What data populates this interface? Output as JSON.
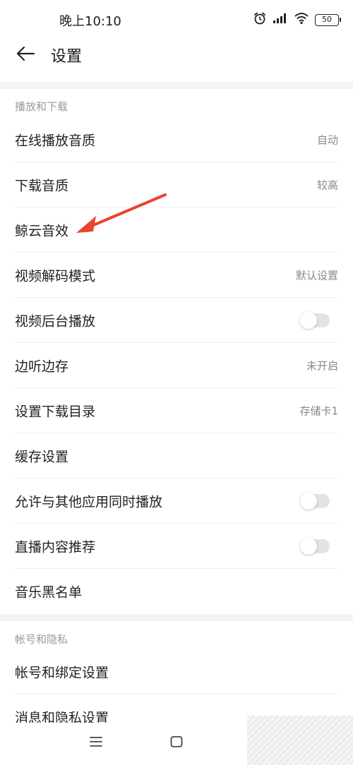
{
  "status_bar": {
    "time": "晚上10:10",
    "battery": "50"
  },
  "header": {
    "title": "设置"
  },
  "sections": [
    {
      "label": "播放和下载",
      "items": [
        {
          "label": "在线播放音质",
          "value": "自动"
        },
        {
          "label": "下载音质",
          "value": "较高"
        },
        {
          "label": "鲸云音效",
          "value": ""
        },
        {
          "label": "视频解码模式",
          "value": "默认设置"
        },
        {
          "label": "视频后台播放",
          "toggle": false
        },
        {
          "label": "边听边存",
          "value": "未开启"
        },
        {
          "label": "设置下载目录",
          "value": "存储卡1"
        },
        {
          "label": "缓存设置",
          "value": ""
        },
        {
          "label": "允许与其他应用同时播放",
          "toggle": false
        },
        {
          "label": "直播内容推荐",
          "toggle": false
        },
        {
          "label": "音乐黑名单",
          "value": ""
        }
      ]
    },
    {
      "label": "帐号和隐私",
      "items": [
        {
          "label": "帐号和绑定设置",
          "value": ""
        },
        {
          "label": "消息和隐私设置",
          "value": ""
        }
      ]
    }
  ],
  "colors": {
    "annotation_arrow": "#e8462b",
    "toggle_off": "#e3e3e3"
  },
  "icons": [
    "alarm-icon",
    "signal-icon",
    "wifi-icon",
    "battery-icon",
    "back-arrow-icon",
    "menu-icon",
    "home-icon"
  ]
}
